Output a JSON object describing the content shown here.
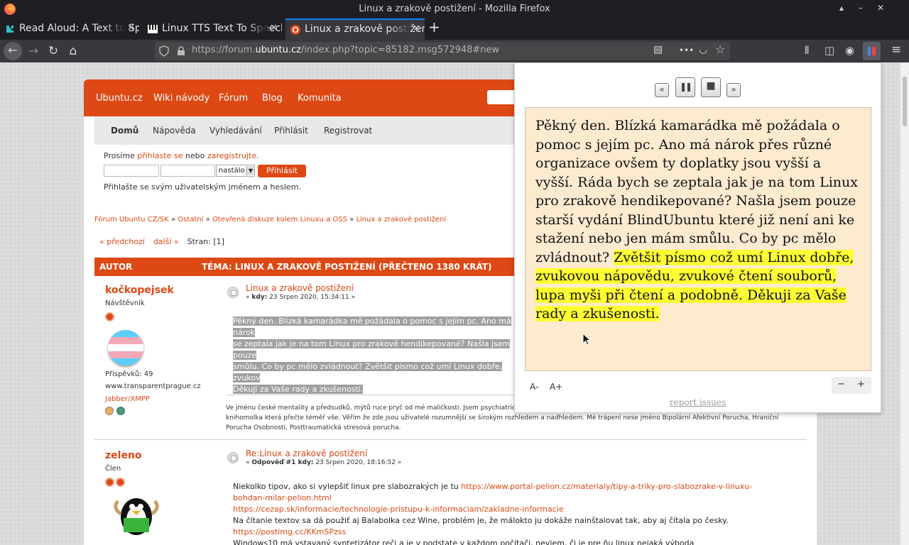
{
  "window": {
    "title": "Linux a zrakově postižení - Mozilla Firefox",
    "controls": [
      "▴",
      "–",
      "✕"
    ]
  },
  "tabs": [
    {
      "label": "Read Aloud: A Text to Spe",
      "close": "✕"
    },
    {
      "label": "Linux TTS Text To Speech",
      "close": "✕"
    },
    {
      "label": "Linux a zrakově postižení",
      "close": "✕"
    }
  ],
  "newtab": "+",
  "nav": {
    "back": "←",
    "forward": "→",
    "reload": "↻",
    "home": "⌂",
    "url_prefix": "https://forum.",
    "url_domain": "ubuntu.cz",
    "url_suffix": "/index.php?topic=85182.msg572948#new",
    "reader_icon": "▤",
    "more_icon": "•••",
    "pocket_icon": "◡",
    "star_icon": "☆",
    "library_icon": "⫴",
    "sidebar_icon": "◫",
    "account_icon": "◉",
    "menu_icon": "≡"
  },
  "site": {
    "topnav": [
      "Ubuntu.cz",
      "Wiki návody",
      "Fórum",
      "Blog",
      "Komunita"
    ],
    "menu": [
      "Domů",
      "Nápověda",
      "Vyhledávání",
      "Přihlásit",
      "Registrovat"
    ],
    "login_prefix": "Prosíme ",
    "login_link1": "přihlaste se",
    "login_mid": " nebo ",
    "login_link2": "zaregistrujte",
    "login_suffix": ".",
    "duration_value": "nastálo",
    "login_button": "Přihlásit",
    "login_hint": "Přihlašte se svým uživatelským jménem a heslem.",
    "breadcrumb": [
      "Fórum Ubuntu CZ/SK",
      "Ostatní",
      "Otevřená diskuze kolem Linuxu a OSS",
      "Linux a zrakově postižení"
    ],
    "breadcrumb_sep": " » ",
    "prev": "« předchozí",
    "next": "další »",
    "pages": "Stran: [1]",
    "col_author": "AUTOR",
    "col_topic": "TÉMA: LINUX A ZRAKOVĚ POSTIŽENÍ  (PŘEČTENO 1380 KRÁT)"
  },
  "posts": [
    {
      "author": "kočkopejsek",
      "rank": "Návštěvník",
      "posts_count": "Příspěvků: 49",
      "website": "www.transparentprague.cz",
      "im": "Jabber/XMPP",
      "title": "Linux a zrakově postižení",
      "meta_prefix": "« ",
      "meta_label": "kdy:",
      "meta_date": " 23 Srpen 2020, 15:34:11 »",
      "body_lines": [
        "Pěkný den. Blízká kamarádka mě požádala o pomoc s jejím pc. Ano má nárok",
        "se zeptala jak je na tom Linux pro zrakově hendikepované?  Našla jsem pouze",
        "smůlu. Co by pc mělo zvládnout? Zvětšit písmo což umí Linux dobře, zvukov",
        "Děkuji za Vaše rady a zkušenosti."
      ],
      "signature": "Ve jménu české mentality a předsudků, mýtů ruce pryč od mé maličkosti. Jsem psychiatricky nemocná transžena, fanynka Linuxu, bývalá středoškolská učitelka a knihomolka která přečte téměř vše. Věřím že zde jsou uživatelé rozumnější se širokým rozhledem a nadhledem. Mé trápení nese jméno Bipolární Afektivní Porucha, Hraniční Porucha Osobnosti, Posttraumatická stresová porucha."
    },
    {
      "author": "zeleno",
      "rank": "Člen",
      "title": "Re:Linux a zrakově postižení",
      "meta_prefix": "« ",
      "meta_label": "Odpověď #1 kdy:",
      "meta_date": " 23 Srpen 2020, 18:16:52 »",
      "line1": "Niekolko tipov, ako si vylepšiť linux pre slabozrakých je tu ",
      "link1": "https://www.portal-pelion.cz/materialy/tipy-a-triky-pro-slabozrake-v-linuxu-bohdan-milar-pelion.html",
      "link2": "https://cezap.sk/informacie/technologie-pristupu-k-informaciam/zakladne-informacie",
      "line2": "Na čítanie textov sa dá použiť aj Balabolka cez Wine, problém je, že málokto ju dokáže nainštalovat tak, aby aj čítala po česky.",
      "link3": "https://postimg.cc/KKmSPzss",
      "line3": "Windows10 má vstavaný syntetizátor reči a je v podstate v každom počítači, neviem, či je pre ňu linux nejaká výboda"
    }
  ],
  "readaloud": {
    "rewind": "«",
    "pause": "❚❚",
    "stop": "■",
    "forward": "»",
    "text_plain": "Pěkný den. Blízká kamarádka mě požádala o pomoc s jejím pc. Ano má nárok přes různé organizace ovšem ty doplatky jsou vyšší a vyšší. Ráda bych se zeptala jak je na tom Linux pro zrakově hendikepované? Našla jsem pouze starší vydání BlindUbuntu které již není ani ke stažení nebo jen mám smůlu. Co by pc mělo zvládnout? ",
    "text_highlighted": "Zvětšit písmo což umí Linux dobře, zvukovou nápovědu, zvukové čtení souborů, lupa myši při čtení a podobně. Děkuji za Vaše rady a zkušenosti.",
    "font_smaller": "A-",
    "font_larger": "A+",
    "zoom_out": "−",
    "zoom_in": "+",
    "report": "report issues"
  },
  "colors": {
    "accent": "#dd4814",
    "highlight": "#ffff33",
    "reader_bg": "#fdebd0"
  }
}
